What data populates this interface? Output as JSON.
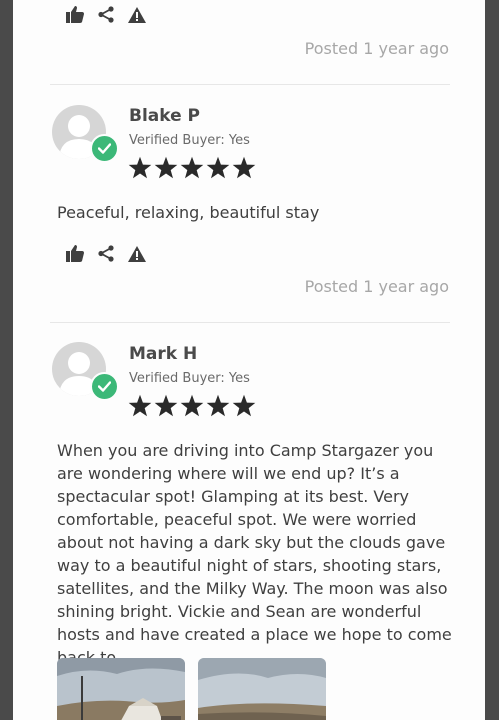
{
  "top_partial": {
    "posted": "Posted 1 year ago"
  },
  "reviews": [
    {
      "name": "Blake P",
      "verified": "Verified Buyer: Yes",
      "rating": 5,
      "text": "Peaceful, relaxing, beautiful stay",
      "posted": "Posted 1 year ago"
    },
    {
      "name": "Mark H",
      "verified": "Verified Buyer: Yes",
      "rating": 5,
      "text": "When you are driving into Camp Stargazer you are wondering where will we end up? It’s a spectacular spot! Glamping at its best. Very comfortable, peaceful spot. We were worried about not having a dark sky but the clouds gave way to a beautiful night of stars, shooting stars, satellites, and the Milky Way. The moon was also shining bright. Vickie and Sean are wonderful hosts and have created a place we hope to come back to."
    }
  ],
  "icons": {
    "like": "thumbs-up-icon",
    "share": "share-icon",
    "report": "warning-icon",
    "verified": "check-badge-icon",
    "star": "star-icon"
  },
  "colors": {
    "badge": "#3cb878",
    "text": "#3f3f3f",
    "muted": "#a7a7a7"
  }
}
